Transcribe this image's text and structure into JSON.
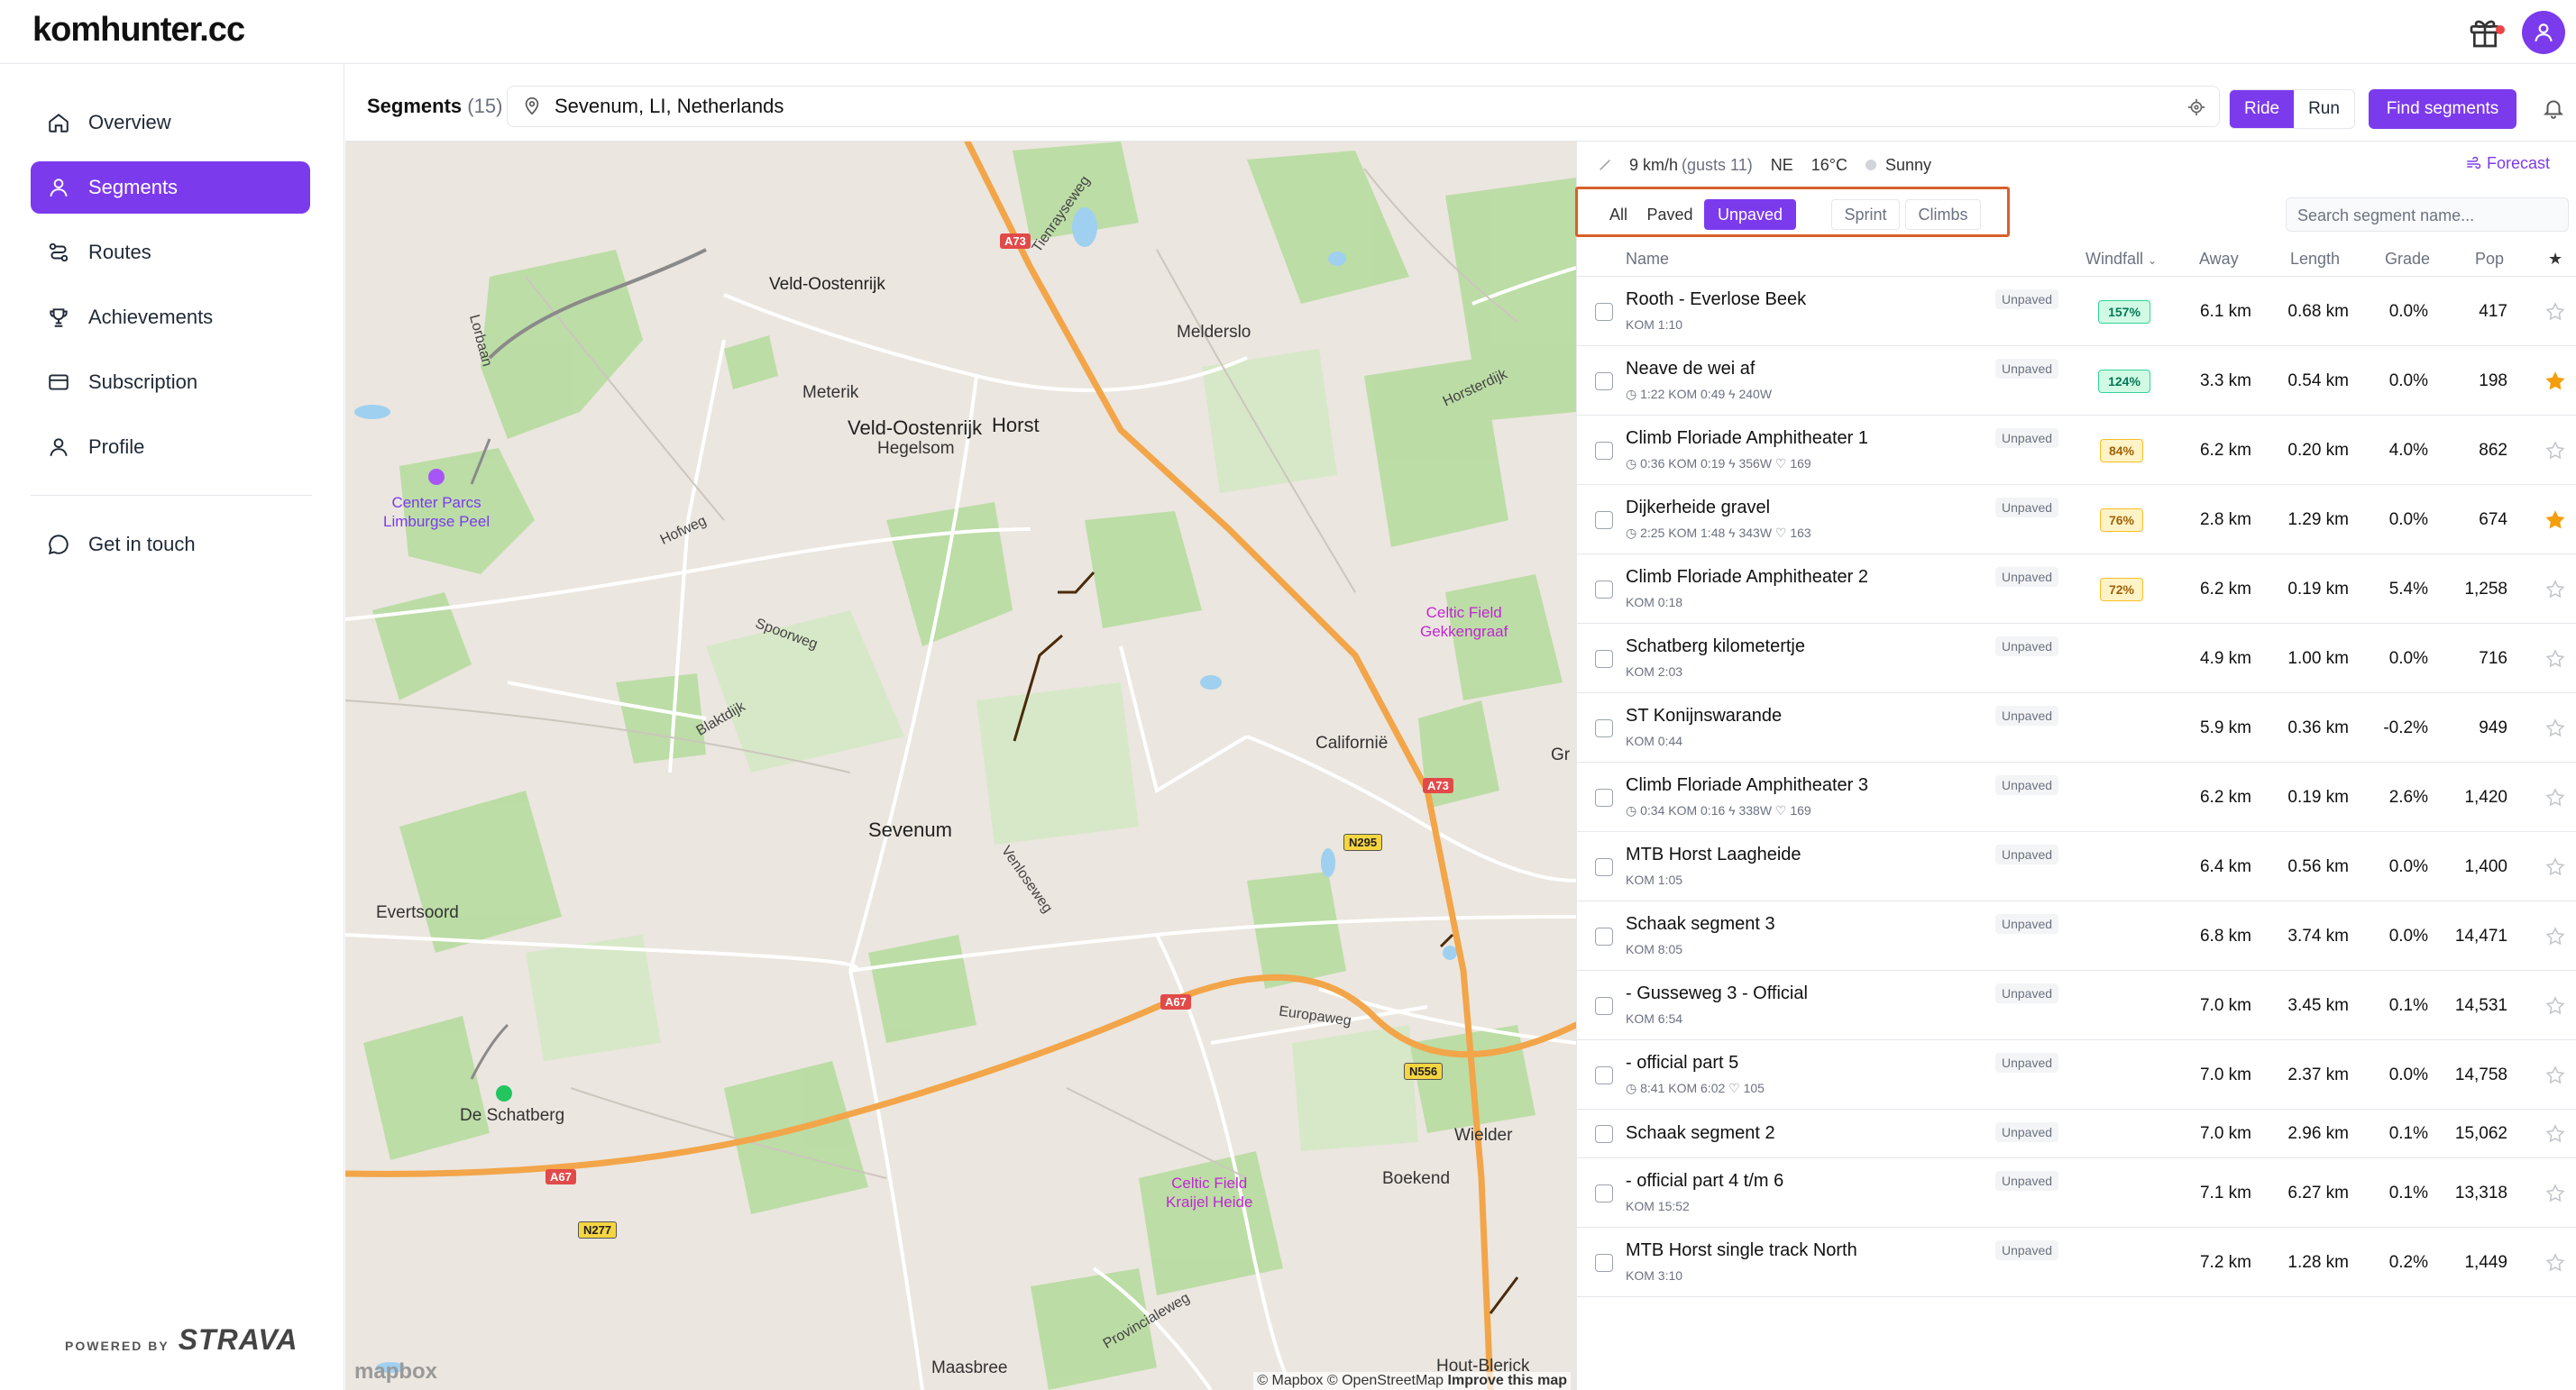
{
  "app": {
    "logo": "komhunter.cc"
  },
  "sidebar": {
    "items": [
      {
        "label": "Overview",
        "icon": "home-icon"
      },
      {
        "label": "Segments",
        "icon": "segments-icon"
      },
      {
        "label": "Routes",
        "icon": "routes-icon"
      },
      {
        "label": "Achievements",
        "icon": "trophy-icon"
      },
      {
        "label": "Subscription",
        "icon": "card-icon"
      },
      {
        "label": "Profile",
        "icon": "user-icon"
      }
    ],
    "contact": {
      "label": "Get in touch",
      "icon": "chat-icon"
    },
    "powered_by": "POWERED BY",
    "strava": "STRAVA"
  },
  "header": {
    "title": "Segments",
    "count": "(15)",
    "location": "Sevenum, LI, Netherlands",
    "activity_options": [
      "Ride",
      "Run"
    ],
    "activity_selected": "Ride",
    "find_label": "Find segments"
  },
  "weather": {
    "wind": "9 km/h",
    "gusts": "(gusts 11)",
    "direction": "NE",
    "temperature": "16°C",
    "condition": "Sunny",
    "forecast_label": "Forecast"
  },
  "filters": {
    "surface": [
      "All",
      "Paved",
      "Unpaved"
    ],
    "surface_selected": "Unpaved",
    "type": [
      "Sprint",
      "Climbs"
    ],
    "search_placeholder": "Search segment name..."
  },
  "table": {
    "headers": {
      "name": "Name",
      "windfall": "Windfall",
      "away": "Away",
      "length": "Length",
      "grade": "Grade",
      "pop": "Pop",
      "star": "★"
    },
    "rows": [
      {
        "name": "Rooth - Everlose Beek",
        "sub": "KOM 1:10",
        "surface": "Unpaved",
        "windfall": "157%",
        "windfall_level": "high",
        "away": "6.1 km",
        "length": "0.68 km",
        "grade": "0.0%",
        "pop": "417",
        "starred": false
      },
      {
        "name": "Neave de wei af",
        "sub": "◷ 1:22  KOM 0:49  ϟ 240W",
        "surface": "Unpaved",
        "windfall": "124%",
        "windfall_level": "high",
        "away": "3.3 km",
        "length": "0.54 km",
        "grade": "0.0%",
        "pop": "198",
        "starred": true
      },
      {
        "name": "Climb Floriade Amphitheater 1",
        "sub": "◷ 0:36  KOM 0:19  ϟ 356W  ♡ 169",
        "surface": "Unpaved",
        "windfall": "84%",
        "windfall_level": "mid",
        "away": "6.2 km",
        "length": "0.20 km",
        "grade": "4.0%",
        "pop": "862",
        "starred": false
      },
      {
        "name": "Dijkerheide gravel",
        "sub": "◷ 2:25  KOM 1:48  ϟ 343W  ♡ 163",
        "surface": "Unpaved",
        "windfall": "76%",
        "windfall_level": "mid",
        "away": "2.8 km",
        "length": "1.29 km",
        "grade": "0.0%",
        "pop": "674",
        "starred": true
      },
      {
        "name": "Climb Floriade Amphitheater 2",
        "sub": "KOM 0:18",
        "surface": "Unpaved",
        "windfall": "72%",
        "windfall_level": "mid",
        "away": "6.2 km",
        "length": "0.19 km",
        "grade": "5.4%",
        "pop": "1,258",
        "starred": false
      },
      {
        "name": "Schatberg kilometertje",
        "sub": "KOM 2:03",
        "surface": "Unpaved",
        "windfall": "",
        "windfall_level": "none",
        "away": "4.9 km",
        "length": "1.00 km",
        "grade": "0.0%",
        "pop": "716",
        "starred": false
      },
      {
        "name": "ST Konijnswarande",
        "sub": "KOM 0:44",
        "surface": "Unpaved",
        "windfall": "",
        "windfall_level": "none",
        "away": "5.9 km",
        "length": "0.36 km",
        "grade": "-0.2%",
        "pop": "949",
        "starred": false
      },
      {
        "name": "Climb Floriade Amphitheater 3",
        "sub": "◷ 0:34  KOM 0:16  ϟ 338W  ♡ 169",
        "surface": "Unpaved",
        "windfall": "",
        "windfall_level": "none",
        "away": "6.2 km",
        "length": "0.19 km",
        "grade": "2.6%",
        "pop": "1,420",
        "starred": false
      },
      {
        "name": "MTB Horst Laagheide",
        "sub": "KOM 1:05",
        "surface": "Unpaved",
        "windfall": "",
        "windfall_level": "none",
        "away": "6.4 km",
        "length": "0.56 km",
        "grade": "0.0%",
        "pop": "1,400",
        "starred": false
      },
      {
        "name": "Schaak segment 3",
        "sub": "KOM 8:05",
        "surface": "Unpaved",
        "windfall": "",
        "windfall_level": "none",
        "away": "6.8 km",
        "length": "3.74 km",
        "grade": "0.0%",
        "pop": "14,471",
        "starred": false
      },
      {
        "name": "- Gusseweg 3 - Official",
        "sub": "KOM 6:54",
        "surface": "Unpaved",
        "windfall": "",
        "windfall_level": "none",
        "away": "7.0 km",
        "length": "3.45 km",
        "grade": "0.1%",
        "pop": "14,531",
        "starred": false
      },
      {
        "name": "- official part 5",
        "sub": "◷ 8:41  KOM 6:02  ♡ 105",
        "surface": "Unpaved",
        "windfall": "",
        "windfall_level": "none",
        "away": "7.0 km",
        "length": "2.37 km",
        "grade": "0.0%",
        "pop": "14,758",
        "starred": false
      },
      {
        "name": "Schaak segment 2",
        "sub": "",
        "surface": "Unpaved",
        "windfall": "",
        "windfall_level": "none",
        "away": "7.0 km",
        "length": "2.96 km",
        "grade": "0.1%",
        "pop": "15,062",
        "starred": false
      },
      {
        "name": "- official part 4 t/m 6",
        "sub": "KOM 15:52",
        "surface": "Unpaved",
        "windfall": "",
        "windfall_level": "none",
        "away": "7.1 km",
        "length": "6.27 km",
        "grade": "0.1%",
        "pop": "13,318",
        "starred": false
      },
      {
        "name": "MTB Horst single track North",
        "sub": "KOM 3:10",
        "surface": "Unpaved",
        "windfall": "",
        "windfall_level": "none",
        "away": "7.2 km",
        "length": "1.28 km",
        "grade": "0.2%",
        "pop": "1,449",
        "starred": false
      }
    ]
  },
  "map": {
    "places": [
      "Veld-Oostenrijk",
      "Melderslo",
      "Meterik",
      "Horst",
      "Hegelsom",
      "Californië",
      "Sevenum",
      "Evertsoord",
      "De Schatberg",
      "Boekend",
      "Wielder",
      "Maasbree",
      "Hout-Blerick",
      "Gr"
    ],
    "pois": [
      "Center Parcs\nLimburgse Peel",
      "Celtic Field\nGekkengraaf",
      "Celtic Field\nKraijel Heide"
    ],
    "roads": [
      "Tienrayseweg",
      "Horsterdijk",
      "Lorbaan",
      "Hofweg",
      "Spoorweg",
      "Blaktdijk",
      "Venloseweg",
      "Europaweg",
      "Provincialeweg"
    ],
    "shields": [
      "A73",
      "A73",
      "N295",
      "A67",
      "N556",
      "A67",
      "N277"
    ],
    "logo": "mapbox",
    "attribution_mapbox": "© Mapbox",
    "attribution_osm": "© OpenStreetMap",
    "improve": "Improve this map"
  },
  "colors": {
    "accent": "#7c3aed",
    "highlight": "#d9602a",
    "star": "#f59e0b"
  }
}
